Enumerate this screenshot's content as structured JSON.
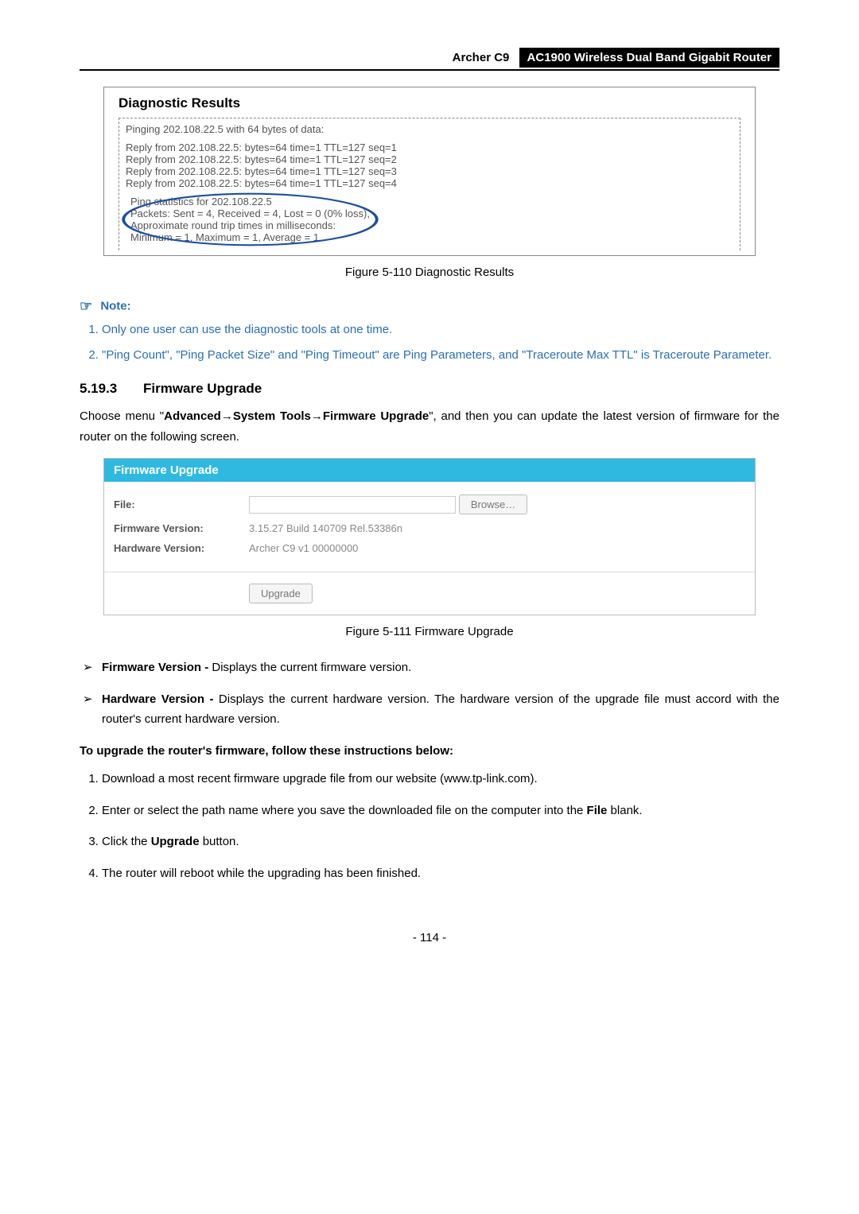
{
  "header": {
    "model": "Archer C9",
    "title": "AC1900 Wireless Dual Band Gigabit Router"
  },
  "diag": {
    "box_title": "Diagnostic Results",
    "ping_header": "Pinging 202.108.22.5 with 64 bytes of data:",
    "replies": [
      "Reply from 202.108.22.5:  bytes=64  time=1  TTL=127  seq=1",
      "Reply from 202.108.22.5:  bytes=64  time=1  TTL=127  seq=2",
      "Reply from 202.108.22.5:  bytes=64  time=1  TTL=127  seq=3",
      "Reply from 202.108.22.5:  bytes=64  time=1  TTL=127  seq=4"
    ],
    "stats": [
      "Ping statistics for 202.108.22.5",
      "  Packets: Sent = 4, Received = 4, Lost = 0 (0% loss),",
      "Approximate round trip times in milliseconds:",
      "  Minimum = 1, Maximum = 1, Average = 1"
    ],
    "caption": "Figure 5-110 Diagnostic Results"
  },
  "note": {
    "label": "Note:",
    "items": [
      "Only one user can use the diagnostic tools at one time.",
      "\"Ping Count\", \"Ping Packet Size\" and \"Ping Timeout\" are Ping Parameters, and \"Traceroute Max TTL\" is Traceroute Parameter."
    ]
  },
  "section": {
    "num": "5.19.3",
    "title": "Firmware Upgrade",
    "intro_pre": "Choose menu \"",
    "intro_path_1": "Advanced",
    "intro_path_2": "System Tools",
    "intro_path_3": "Firmware Upgrade",
    "intro_post": "\", and then you can update the latest version of firmware for the router on the following screen."
  },
  "panel": {
    "title": "Firmware Upgrade",
    "file_label": "File:",
    "browse_btn": "Browse…",
    "fw_label": "Firmware Version:",
    "fw_value": "3.15.27 Build 140709 Rel.53386n",
    "hw_label": "Hardware Version:",
    "hw_value": "Archer C9 v1 00000000",
    "upgrade_btn": "Upgrade",
    "caption": "Figure 5-111 Firmware Upgrade"
  },
  "bullets": {
    "fw_b": "Firmware Version - ",
    "fw_t": "Displays the current firmware version.",
    "hw_b": "Hardware Version - ",
    "hw_t": "Displays the current hardware version. The hardware version of the upgrade file must accord with the router's current hardware version."
  },
  "instr_title": "To upgrade the router's firmware, follow these instructions below:",
  "steps": {
    "s1": "Download a most recent firmware upgrade file from our website (www.tp-link.com).",
    "s2_a": "Enter or select the path name where you save the downloaded file on the computer into the ",
    "s2_b": "File",
    "s2_c": " blank.",
    "s3_a": "Click the ",
    "s3_b": "Upgrade",
    "s3_c": " button.",
    "s4": "The router will reboot while the upgrading has been finished."
  },
  "page_num": "- 114 -"
}
